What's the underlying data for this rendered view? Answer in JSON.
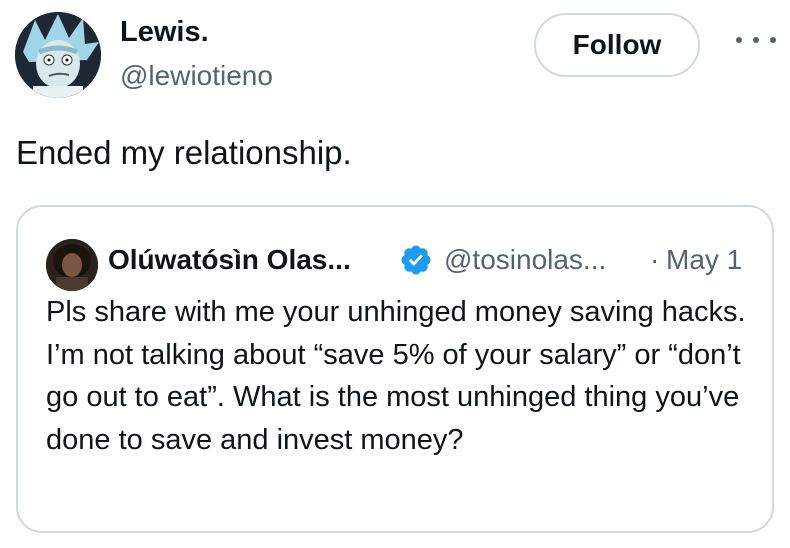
{
  "author": {
    "name": "Lewis.",
    "handle": "@lewiotieno"
  },
  "actions": {
    "follow_label": "Follow",
    "more_icon": "more-horizontal-icon"
  },
  "tweet": {
    "text": "Ended my relationship."
  },
  "quoted_tweet": {
    "name": "Olúwatósìn Olas...",
    "verified_icon": "verified-badge-icon",
    "handle": "@tosinolas...",
    "separator": "·",
    "date": "May 1",
    "text": "Pls share with me your unhinged money saving hacks. I’m not talking about “save 5% of your salary” or “don’t go out to eat”. What is the most unhinged thing you’ve done to save and invest money?"
  },
  "colors": {
    "primary_text": "#0f1419",
    "secondary_text": "#536471",
    "border": "#cfd9de",
    "verified_blue": "#1d9bf0"
  }
}
